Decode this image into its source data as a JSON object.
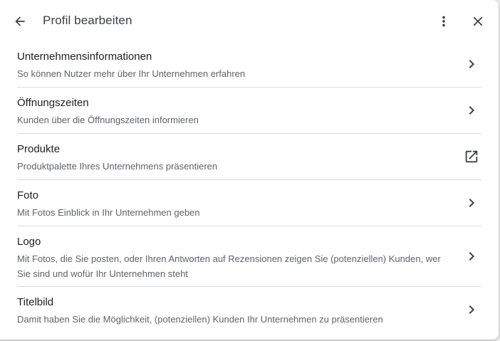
{
  "header": {
    "title": "Profil bearbeiten"
  },
  "icons": {
    "back": "arrow-back-icon",
    "more": "more-vert-icon",
    "close": "close-icon",
    "chevron": "chevron-right-icon",
    "external": "open-in-new-icon"
  },
  "colors": {
    "text_primary": "#202124",
    "text_secondary": "#5f6368",
    "icon": "#5f6368",
    "divider": "#dadce0"
  },
  "items": [
    {
      "title": "Unternehmensinformationen",
      "description": "So können Nutzer mehr über Ihr Unternehmen erfahren",
      "icon": "chevron-right-icon"
    },
    {
      "title": "Öffnungszeiten",
      "description": "Kunden über die Öffnungszeiten informieren",
      "icon": "chevron-right-icon"
    },
    {
      "title": "Produkte",
      "description": "Produktpalette Ihres Unternehmens präsentieren",
      "icon": "open-in-new-icon"
    },
    {
      "title": "Foto",
      "description": "Mit Fotos Einblick in Ihr Unternehmen geben",
      "icon": "chevron-right-icon"
    },
    {
      "title": "Logo",
      "description": "Mit Fotos, die Sie posten, oder Ihren Antworten auf Rezensionen zeigen Sie (potenziellen) Kunden, wer Sie sind und wofür Ihr Unternehmen steht",
      "icon": "chevron-right-icon"
    },
    {
      "title": "Titelbild",
      "description": "Damit haben Sie die Möglichkeit, (potenziellen) Kunden Ihr Unternehmen zu präsentieren",
      "icon": "chevron-right-icon"
    }
  ]
}
